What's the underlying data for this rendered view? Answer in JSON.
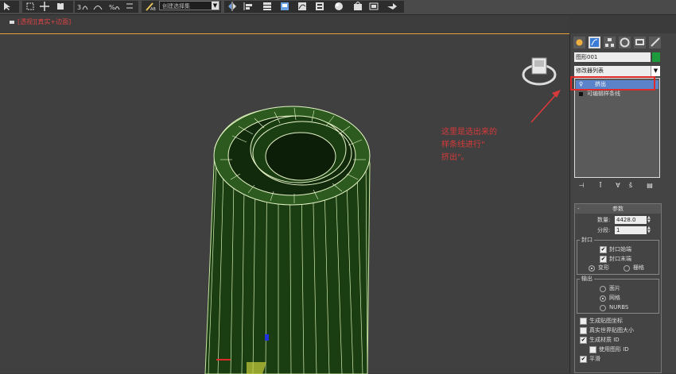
{
  "toolbar": {
    "selection_dropdown_value": "创建选择集",
    "icons": [
      "select-arrow-icon",
      "move-icon",
      "rotate-icon",
      "snap-3d-icon",
      "angle-snap-icon",
      "percent-snap-icon",
      "spinner-snap-icon",
      "edit-named-sets-icon",
      "mirror-icon",
      "align-icon",
      "layer-manager-icon",
      "graphite-icon",
      "curve-editor-icon",
      "schematic-icon",
      "material-editor-icon",
      "render-setup-icon",
      "render-frame-icon",
      "render-icon"
    ]
  },
  "viewport": {
    "label": "[透视][真实+边面]",
    "annotation": "这里是选出来的\n样条线进行\"\n挤出\"。"
  },
  "command_panel": {
    "tabs": [
      "create-icon",
      "modify-icon",
      "hierarchy-icon",
      "motion-icon",
      "display-icon",
      "utilities-icon"
    ],
    "object_name": "图形001",
    "object_color": "#1d9a3a",
    "modifier_list_label": "修改器列表",
    "modifier_stack": [
      {
        "label": "挤出",
        "selected": true
      },
      {
        "label": "可编辑样条线",
        "selected": false
      }
    ],
    "stack_buttons": [
      "pin-stack-icon",
      "show-end-result-icon",
      "make-unique-icon",
      "remove-modifier-icon",
      "configure-sets-icon"
    ],
    "params": {
      "title": "参数",
      "amount_label": "数量:",
      "amount_value": "4428.0",
      "segments_label": "分段:",
      "segments_value": "1",
      "capping": {
        "title": "封口",
        "cap_start": "封口始端",
        "cap_end": "封口末端",
        "morph": "变形",
        "grid": "栅格"
      },
      "output": {
        "title": "输出",
        "patch": "面片",
        "mesh": "网格",
        "nurbs": "NURBS"
      },
      "gen_mapping": "生成贴图坐标",
      "real_world": "真实世界贴图大小",
      "gen_mat_ids": "生成材质 ID",
      "use_shape_ids": "使用图形 ID",
      "smooth": "平滑"
    }
  }
}
